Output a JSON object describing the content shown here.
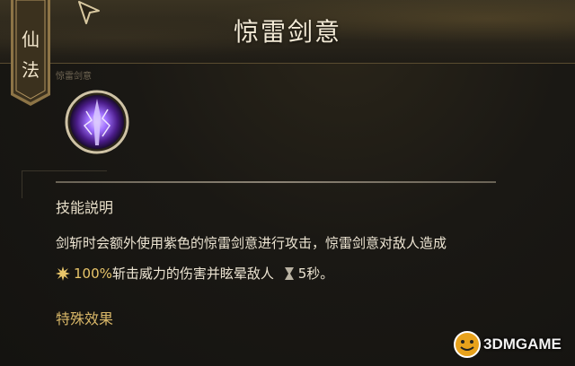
{
  "header": {
    "title": "惊雷剑意",
    "category_tab": [
      "仙",
      "法"
    ]
  },
  "skill": {
    "label_small": "惊雷剑意"
  },
  "description": {
    "section_title": "技能説明",
    "line1": "剑斩时会额外使用紫色的惊雷剑意进行攻击，惊雷剑意对敌人造成",
    "line2_highlight": "100%",
    "line2_text": "斩击威力的伤害并眩晕敌人",
    "line2_duration": "5秒。"
  },
  "special_effects": {
    "title": "特殊效果"
  },
  "watermark": {
    "text": "3DMGAME"
  },
  "icons": {
    "skill": "purple-sword-lightning-icon",
    "damage": "burst-star-icon",
    "duration": "hourglass-icon",
    "cursor": "arrow-cursor-icon"
  },
  "colors": {
    "accent_gold": "#d9b768",
    "highlight": "#e9c66a",
    "skill_glow": "#a070ff"
  }
}
